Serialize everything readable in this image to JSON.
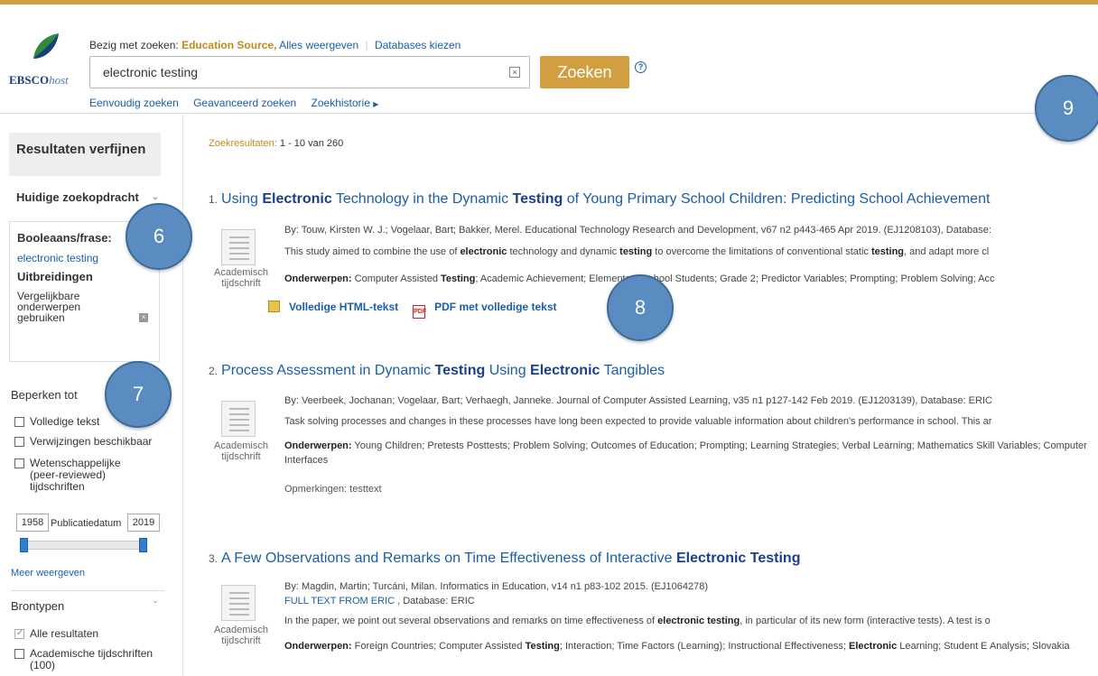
{
  "header": {
    "logo_text": "EBSCO",
    "logo_host": "host",
    "searching_label": "Bezig met zoeken:",
    "database": "Education Source,",
    "show_all": "Alles weergeven",
    "choose_db": "Databases kiezen",
    "query": "electronic testing",
    "search_button": "Zoeken",
    "help": "?",
    "links": [
      "Eenvoudig zoeken",
      "Geavanceerd zoeken",
      "Zoekhistorie"
    ]
  },
  "callouts": [
    "6",
    "7",
    "8",
    "9"
  ],
  "sidebar": {
    "refine_title": "Resultaten verfijnen",
    "current_query_title": "Huidige zoekopdracht",
    "boolean_label": "Booleaans/frase:",
    "boolean_term": "electronic testing",
    "extensions_label": "Uitbreidingen",
    "extension_item": "Vergelijkbare onderwerpen gebruiken",
    "limit_title": "Beperken tot",
    "limits": [
      "Volledige tekst",
      "Verwijzingen beschikbaar",
      "Wetenschappelijke (peer-reviewed) tijdschriften"
    ],
    "year_from": "1958",
    "pub_date_label": "Publicatiedatum",
    "year_to": "2019",
    "more_link": "Meer weergeven",
    "source_types_title": "Brontypen",
    "source_types": [
      "Alle resultaten",
      "Academische tijdschriften (100)"
    ]
  },
  "results": {
    "summary_label": "Zoekresultaten:",
    "summary_range": "1 - 10 van 260",
    "type_label": "Academisch tijdschrift",
    "subjects_label": "Onderwerpen:",
    "items": [
      {
        "num": "1.",
        "title_parts": [
          "Using ",
          "Electronic",
          " Technology in the Dynamic ",
          "Testing",
          " of Young Primary School Children: Predicting School Achievement"
        ],
        "byline": "By: Touw, Kirsten W. J.; Vogelaar, Bart; Bakker, Merel. Educational Technology Research and Development, v67 n2 p443-465 Apr 2019. (EJ1208103), Database:",
        "abstract_parts": [
          "This study aimed to combine the use of ",
          "electronic",
          " technology and dynamic ",
          "testing",
          " to overcome the limitations of conventional static ",
          "testing",
          ", and adapt more cl"
        ],
        "subjects_parts": [
          " Computer Assisted ",
          "Testing",
          "; Academic Achievement; Elementary School Students; Grade 2; Predictor Variables; Prompting; Problem Solving; Acc"
        ],
        "html_fulltext": "Volledige HTML-tekst",
        "pdf_fulltext": "PDF met volledige tekst"
      },
      {
        "num": "2.",
        "title_parts": [
          "Process Assessment in Dynamic ",
          "Testing",
          " Using ",
          "Electronic",
          " Tangibles"
        ],
        "byline": "By: Veerbeek, Jochanan; Vogelaar, Bart; Verhaegh, Janneke. Journal of Computer Assisted Learning, v35 n1 p127-142 Feb 2019. (EJ1203139), Database: ERIC",
        "abstract": "Task solving processes and changes in these processes have long been expected to provide valuable information about children's performance in school. This ar",
        "subjects": " Young Children; Pretests Posttests; Problem Solving; Outcomes of Education; Prompting; Learning Strategies; Verbal Learning; Mathematics Skill Variables; Computer Interfaces",
        "notes": "Opmerkingen:  testtext"
      },
      {
        "num": "3.",
        "title_parts": [
          "A Few Observations and Remarks on Time Effectiveness of Interactive ",
          "Electronic",
          " ",
          "Testing",
          ""
        ],
        "byline": "By: Magdin, Martin; Turcáni, Milan. Informatics in Education, v14 n1 p83-102 2015. (EJ1064278)",
        "full_text_eric": "FULL TEXT FROM ERIC",
        "database_eric": " , Database: ERIC",
        "abstract_parts": [
          "In the paper, we point out several observations and remarks on time effectiveness of ",
          "electronic testing",
          ", in particular of its new form (interactive tests). A test is o"
        ],
        "subjects_parts": [
          " Foreign Countries; Computer Assisted ",
          "Testing",
          "; Interaction; Time Factors (Learning); Instructional Effectiveness; ",
          "Electronic",
          " Learning; Student E Analysis; Slovakia"
        ]
      }
    ]
  }
}
